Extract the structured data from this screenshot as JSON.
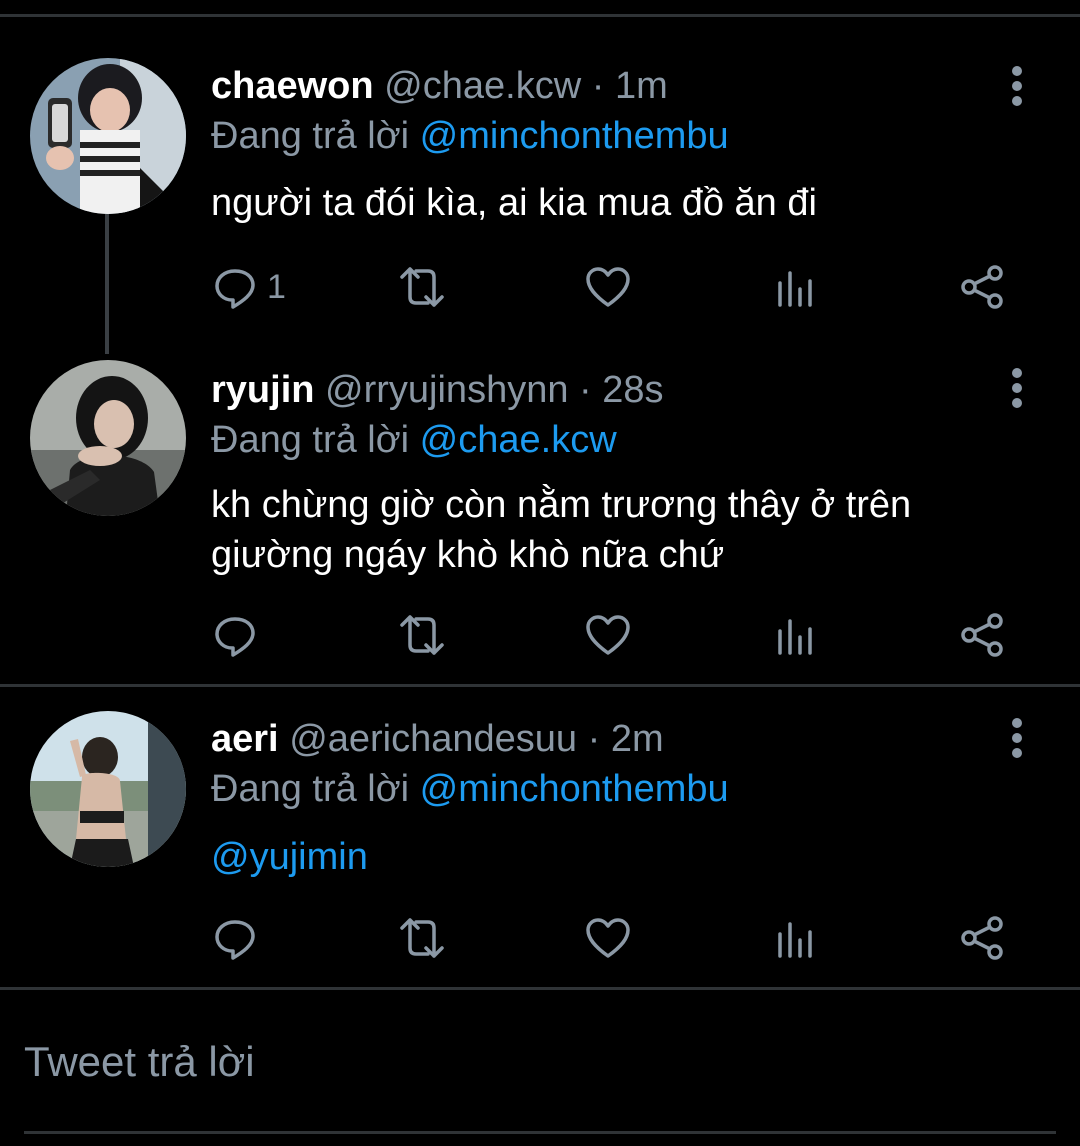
{
  "tweets": [
    {
      "name": "chaewon",
      "handle": "@chae.kcw",
      "dot": "·",
      "time": "1m",
      "reply_prefix": "Đang trả lời",
      "reply_to": "@minchonthembu",
      "text": "người ta đói kìa, ai kia mua đồ ăn đi",
      "reply_count": "1"
    },
    {
      "name": "ryujin",
      "handle": "@rryujinshynn",
      "dot": "·",
      "time": "28s",
      "reply_prefix": "Đang trả lời",
      "reply_to": "@chae.kcw",
      "text": "kh chừng giờ còn nằm trương thây ở trên giường ngáy khò khò nữa chứ",
      "reply_count": ""
    },
    {
      "name": "aeri",
      "handle": "@aerichandesuu",
      "dot": "·",
      "time": "2m",
      "reply_prefix": "Đang trả lời",
      "reply_to": "@minchonthembu",
      "text": "@yujimin",
      "reply_count": ""
    }
  ],
  "compose": {
    "placeholder": "Tweet trả lời"
  },
  "colors": {
    "background": "#000000",
    "secondary_text": "#8b98a5",
    "accent": "#1d9bf0",
    "divider": "#2f3336"
  },
  "icons": {
    "reply": "reply-icon",
    "retweet": "retweet-icon",
    "like": "heart-icon",
    "stats": "analytics-icon",
    "share": "share-icon",
    "more": "more-vertical-icon"
  }
}
